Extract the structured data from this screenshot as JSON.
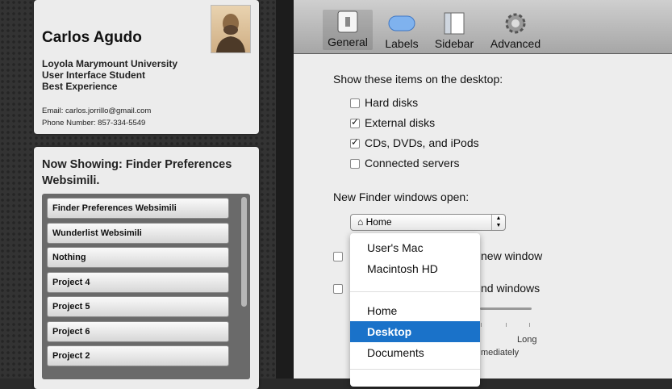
{
  "profile": {
    "name": "Carlos Agudo",
    "school": "Loyola Marymount University",
    "role": "User Interface Student",
    "award": "Best Experience",
    "email": "Email: carlos.jorrillo@gmail.com",
    "phone": "Phone Number: 857-334-5549"
  },
  "showing": {
    "title": "Now Showing: Finder Preferences Websimili.",
    "items": [
      "Finder Preferences Websimili",
      "Wunderlist Websimili",
      "Nothing",
      "Project 4",
      "Project 5",
      "Project 6",
      "Project 2"
    ]
  },
  "toolbar": {
    "tabs": [
      {
        "label": "General",
        "icon": "general-icon"
      },
      {
        "label": "Labels",
        "icon": "labels-icon"
      },
      {
        "label": "Sidebar",
        "icon": "sidebar-icon"
      },
      {
        "label": "Advanced",
        "icon": "gear-icon"
      }
    ]
  },
  "prefs": {
    "desktop_heading": "Show these items on the desktop:",
    "items": [
      {
        "label": "Hard disks",
        "checked": false
      },
      {
        "label": "External disks",
        "checked": true
      },
      {
        "label": "CDs, DVDs, and iPods",
        "checked": true
      },
      {
        "label": "Connected servers",
        "checked": false
      }
    ],
    "new_window_heading": "New Finder windows open:",
    "select_value": "Home",
    "option_row1_partial": "new window",
    "option_row2_partial": "nd windows",
    "slider_label_long": "Long",
    "slider_caption_partial": "mediately",
    "slider_level_fraction": 1.0
  },
  "menu": {
    "options": [
      "User's Mac",
      "Macintosh HD",
      "Home",
      "Desktop",
      "Documents"
    ],
    "selected": "Desktop"
  },
  "colors": {
    "selection": "#1a72c9",
    "panel": "#ececec",
    "background": "#333333"
  }
}
